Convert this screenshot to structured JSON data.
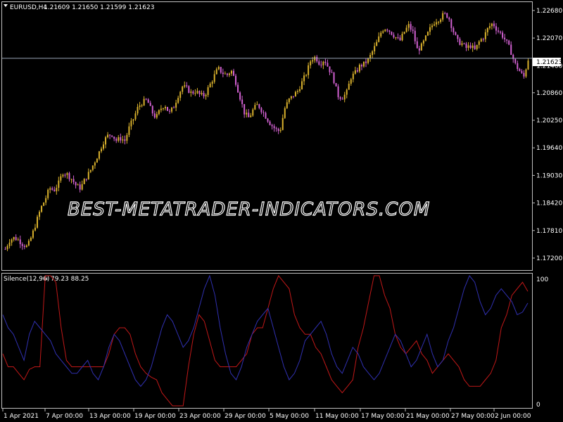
{
  "chart_header": {
    "symbol_label": "EURUSD,H4",
    "ohlc": "1.21609 1.21650 1.21599 1.21623"
  },
  "price_axis": {
    "ticks": [
      "1.22680",
      "1.22070",
      "1.21460",
      "1.20860",
      "1.20250",
      "1.19640",
      "1.19030",
      "1.18420",
      "1.17810",
      "1.17200"
    ],
    "current_price": "1.21623"
  },
  "watermark": "BEST-METATRADER-INDICATORS.COM",
  "indicator": {
    "name": "Silence(12,96)",
    "values": "79.23 88.25",
    "axis_top": "100",
    "axis_bottom": "0"
  },
  "time_axis": {
    "labels": [
      "1 Apr 2021",
      "7 Apr 00:00",
      "13 Apr 00:00",
      "19 Apr 00:00",
      "23 Apr 00:00",
      "29 Apr 00:00",
      "5 May 00:00",
      "11 May 00:00",
      "17 May 00:00",
      "21 May 00:00",
      "27 May 00:00",
      "2 Jun 00:00"
    ]
  },
  "colors": {
    "background": "#000000",
    "frame": "#c0c0c0",
    "bull_candle": "#d8b02c",
    "bear_candle": "#d060d0",
    "price_line": "#9aa6b8",
    "silence_red": "#c01818",
    "silence_blue": "#3030b0"
  },
  "chart_data": [
    {
      "type": "candlestick",
      "symbol": "EURUSD",
      "timeframe": "H4",
      "ylim": [
        1.1695,
        1.2285
      ],
      "x": [
        "1 Apr 2021",
        "7 Apr 00:00",
        "13 Apr 00:00",
        "19 Apr 00:00",
        "23 Apr 00:00",
        "29 Apr 00:00",
        "5 May 00:00",
        "11 May 00:00",
        "17 May 00:00",
        "21 May 00:00",
        "27 May 00:00",
        "2 Jun 00:00"
      ],
      "close_path": [
        1.174,
        1.176,
        1.1765,
        1.176,
        1.175,
        1.1745,
        1.177,
        1.18,
        1.183,
        1.185,
        1.1875,
        1.187,
        1.1885,
        1.191,
        1.1905,
        1.1895,
        1.188,
        1.1875,
        1.1895,
        1.191,
        1.193,
        1.195,
        1.1975,
        1.199,
        1.1995,
        1.198,
        1.1985,
        1.198,
        1.201,
        1.203,
        1.2055,
        1.2065,
        1.207,
        1.2045,
        1.203,
        1.205,
        1.206,
        1.204,
        1.2055,
        1.208,
        1.21,
        1.2095,
        1.2085,
        1.209,
        1.208,
        1.208,
        1.21,
        1.212,
        1.214,
        1.213,
        1.2125,
        1.2135,
        1.211,
        1.2075,
        1.204,
        1.203,
        1.205,
        1.206,
        1.2045,
        1.203,
        1.2015,
        1.2005,
        1.2,
        1.205,
        1.207,
        1.208,
        1.209,
        1.211,
        1.213,
        1.216,
        1.2165,
        1.215,
        1.216,
        1.214,
        1.212,
        1.208,
        1.2075,
        1.2085,
        1.212,
        1.213,
        1.2145,
        1.215,
        1.216,
        1.218,
        1.22,
        1.2225,
        1.223,
        1.222,
        1.221,
        1.22,
        1.222,
        1.2235,
        1.222,
        1.218,
        1.219,
        1.221,
        1.223,
        1.2245,
        1.225,
        1.226,
        1.2255,
        1.2225,
        1.22,
        1.2195,
        1.2185,
        1.219,
        1.218,
        1.22,
        1.221,
        1.223,
        1.224,
        1.2225,
        1.2215,
        1.22,
        1.218,
        1.215,
        1.2135,
        1.212,
        1.216
      ]
    },
    {
      "type": "line",
      "title": "Silence(12,96)",
      "ylim": [
        0,
        100
      ],
      "series": [
        {
          "values": [
            40,
            30,
            30,
            25,
            20,
            28,
            30,
            30,
            100,
            100,
            95,
            60,
            35,
            30,
            30,
            30,
            30,
            30,
            30,
            30,
            40,
            55,
            60,
            60,
            55,
            40,
            30,
            25,
            22,
            20,
            10,
            5,
            0,
            0,
            0,
            30,
            55,
            70,
            65,
            50,
            35,
            30,
            30,
            30,
            30,
            35,
            40,
            55,
            60,
            60,
            75,
            90,
            100,
            95,
            90,
            70,
            60,
            55,
            55,
            45,
            40,
            30,
            20,
            15,
            10,
            15,
            20,
            45,
            60,
            80,
            100,
            100,
            85,
            75,
            55,
            45,
            40,
            45,
            50,
            40,
            35,
            25,
            30,
            35,
            40,
            35,
            30,
            20,
            15,
            15,
            15,
            20,
            25,
            35,
            60,
            70,
            85,
            90,
            95,
            88
          ]
        },
        {
          "values": [
            70,
            60,
            55,
            45,
            35,
            55,
            65,
            60,
            55,
            50,
            40,
            35,
            30,
            25,
            25,
            30,
            35,
            25,
            20,
            30,
            45,
            55,
            50,
            40,
            30,
            20,
            15,
            20,
            30,
            45,
            60,
            70,
            65,
            55,
            45,
            50,
            60,
            75,
            90,
            100,
            85,
            60,
            40,
            25,
            20,
            30,
            45,
            55,
            65,
            70,
            75,
            60,
            45,
            30,
            20,
            25,
            35,
            50,
            55,
            60,
            65,
            55,
            40,
            30,
            25,
            35,
            45,
            40,
            30,
            25,
            20,
            25,
            35,
            45,
            55,
            50,
            40,
            30,
            35,
            45,
            55,
            40,
            30,
            35,
            50,
            60,
            75,
            90,
            100,
            95,
            80,
            70,
            75,
            85,
            90,
            85,
            80,
            70,
            72,
            79
          ]
        }
      ]
    }
  ]
}
